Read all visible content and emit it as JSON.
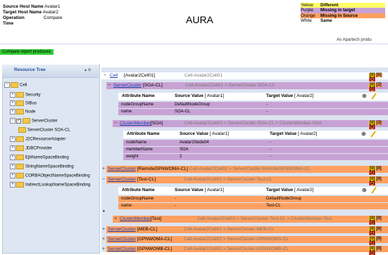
{
  "header": {
    "source_host_label": "Source Host Name",
    "source_host_value": "Avatar1",
    "target_host_label": "Target Host Name",
    "target_host_value": "Avatar2",
    "operation_label": "Operation",
    "operation_value": "Compare",
    "time_label": "Time",
    "app_title": "AURA",
    "byline": "An Apartech produ"
  },
  "legend": [
    {
      "color": "Yellow",
      "text": "Different",
      "swatch": "#ffff66"
    },
    {
      "color": "Purple",
      "text": "Missing in target",
      "swatch": "#c8a2d4"
    },
    {
      "color": "Orange",
      "text": "Missing in Source",
      "swatch": "#ffa060"
    },
    {
      "color": "White",
      "text": "Same",
      "swatch": "#ffffff"
    }
  ],
  "status": "Compare report produced.",
  "tree": {
    "title": "Resource Tree",
    "controls": "▴ ⊘",
    "items": [
      "Cell",
      "Security",
      "SIBus",
      "Node",
      "ServerCluster",
      "ServerCluster SOA-CL",
      "J2CResourceAdapter",
      "JDBCProvider",
      "EjbNameSpaceBinding",
      "StringNameSpaceBinding",
      "CORBAObjectNameSpaceBinding",
      "IndirectLookupNameSpaceBinding"
    ]
  },
  "report": {
    "cell": {
      "name": "Cell",
      "label": "[Avatar2Cell01]",
      "path": "Cell-Avatar2Cell01",
      "badges": [
        "[0]",
        "[0]",
        "[1]"
      ]
    },
    "sc_soa": {
      "name": "ServerCluster",
      "label": "[SOA-CL]",
      "path": "Cell-Avatar2Cell01 > ServerCluster-SOA-CL",
      "badges": [
        "[0]",
        "[2]",
        "[0]"
      ]
    },
    "table1": {
      "col_attr": "Attribute Name",
      "col_source": "Source Value",
      "col_source_host": "[ Avatar1]",
      "col_target": "Target Value",
      "col_target_host": "[ Avatar2]",
      "rows": [
        {
          "name": "nodeGroupName",
          "source": "DefaultNodeGroup",
          "target": "-"
        },
        {
          "name": "name",
          "source": "SOA-CL",
          "target": "-"
        }
      ]
    },
    "cm_soa": {
      "name": "ClusterMember",
      "label": "[SOA]",
      "path": "Cell-Avatar2Cell01 > ServerCluster-SOA-CL > ClusterMember-SOA",
      "badges": [
        "[0]",
        "[3]",
        "[0]"
      ]
    },
    "table2": {
      "col_attr": "Attribute Name",
      "col_source": "Source Value",
      "col_source_host": "[ Avatar1]",
      "col_target": "Target Value",
      "col_target_host": "[ Avatar2]",
      "rows": [
        {
          "name": "nodeName",
          "source": "Avatar1Node04",
          "target": "-"
        },
        {
          "name": "memberName",
          "source": "SOA",
          "target": "-"
        },
        {
          "name": "weight",
          "source": "2",
          "target": "-"
        }
      ]
    },
    "sc_remote": {
      "name": "ServerCluster",
      "label": "[RemoteGPNWOMA-CL]",
      "path": "Cell-Avatar2Cell01 > ServerCluster-RemoteGPNWOMA-CL",
      "badges": [
        "[0]",
        "[0]",
        "[2]"
      ]
    },
    "sc_test": {
      "name": "ServerCluster",
      "label": "[Test-CL]",
      "path": "Cell-Avatar2Cell01 > ServerCluster-Test-CL",
      "badges": [
        "[0]",
        "[0]",
        "[2]"
      ]
    },
    "table3": {
      "col_attr": "Attribute Name",
      "col_source": "Source Value",
      "col_source_host": "[ Avatar1]",
      "col_target": "Target Value",
      "col_target_host": "[ Avatar2]",
      "rows": [
        {
          "name": "nodeGroupName",
          "source": "-",
          "target": "DefaultNodeGroup"
        },
        {
          "name": "name",
          "source": "-",
          "target": "Test-CL"
        }
      ]
    },
    "cm_test": {
      "name": "ClusterMember",
      "label": "[Test]",
      "path": "Cell-Avatar2Cell01 > ServerCluster-Test-CL > ClusterMember-Test",
      "badges": [
        "[0]",
        "[0]",
        "[3]"
      ]
    },
    "sc_meb": {
      "name": "ServerCluster",
      "label": "[MEB-CL]",
      "path": "Cell-Avatar2Cell01 > ServerCluster-MEB-CL",
      "badges": [
        "[0]",
        "[0]",
        "[2]"
      ]
    },
    "sc_gpnwoma": {
      "name": "ServerCluster",
      "label": "[GPNWOMA-CL]",
      "path": "Cell-Avatar2Cell01 > ServerCluster-GPNWOMA-CL",
      "badges": [
        "[0]",
        "[0]",
        "[2]"
      ]
    },
    "sc_gpnwomb": {
      "name": "ServerCluster",
      "label": "[GPNWOMB-CL]",
      "path": "Cell-Avatar2Cell01 > ServerCluster-GPNWOMB-CL",
      "badges": [
        "[0]",
        "[0]",
        "[2]"
      ]
    }
  }
}
